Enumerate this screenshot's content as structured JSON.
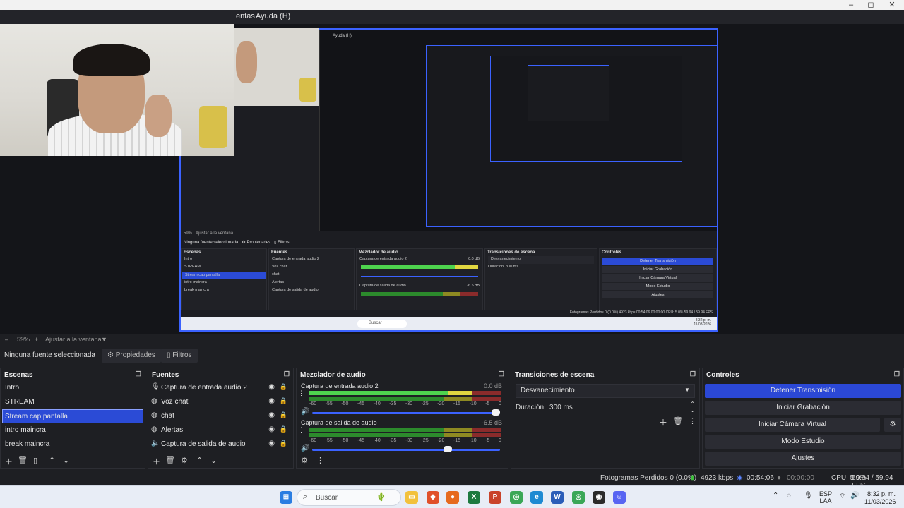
{
  "window": {
    "minimize": "–",
    "maximize": "◻",
    "close": "✕"
  },
  "menu": {
    "items": [
      "entas",
      "Ayuda (H)"
    ]
  },
  "nested_preview": {
    "menu_label": "Ayuda (H)",
    "zoom": "59%",
    "fit": "Ajustar a la ventana",
    "no_source": "Ninguna fuente seleccionada",
    "properties": "Propiedades",
    "filters": "Filtros",
    "panels": [
      "Escenas",
      "Fuentes",
      "Mezclador de audio",
      "Transiciones de escena",
      "Controles"
    ],
    "scenes": [
      "Intro",
      "STREAM",
      "Stream cap pantalla",
      "intro maincra",
      "break maincra"
    ],
    "sources": [
      "Captura de entrada audio 2",
      "Voz chat",
      "chat",
      "Alertas",
      "Captura de salida de audio"
    ],
    "mixer": [
      "Captura de entrada audio 2",
      "Captura de salida de audio"
    ],
    "mixer_db": [
      "0.0 dB",
      "-6.5 dB"
    ],
    "transition": "Desvanecimiento",
    "duration_label": "Duración",
    "duration": "300 ms",
    "controls": [
      "Detener Transmisión",
      "Iniciar Grabación",
      "Iniciar Cámara Virtual",
      "Modo Estudio",
      "Ajustes"
    ],
    "status": "Fotogramas Perdidos 0 (0.0%)   4923 kbps   00:54:06   00:00:00   CPU: 5.0%   59.94 / 59.94 FPS",
    "search": "Buscar",
    "clock_time": "8:32 p. m.",
    "clock_date": "11/03/2026"
  },
  "zoombar": {
    "minus": "–",
    "zoom": "59%",
    "plus": "+",
    "fit": "Ajustar a la ventana",
    "caret": "▼"
  },
  "sourcebar": {
    "no_source": "Ninguna fuente seleccionada",
    "properties": "Propiedades",
    "filters": "Filtros"
  },
  "scenes": {
    "title": "Escenas",
    "items": [
      "Intro",
      "STREAM",
      "Stream cap pantalla",
      "intro maincra",
      "break maincra"
    ],
    "selected_index": 2
  },
  "sources": {
    "title": "Fuentes",
    "items": [
      {
        "label": "Captura de entrada audio 2",
        "icon": "microphone-icon"
      },
      {
        "label": "Voz chat",
        "icon": "browser-icon"
      },
      {
        "label": "chat",
        "icon": "browser-icon"
      },
      {
        "label": "Alertas",
        "icon": "browser-icon"
      },
      {
        "label": "Captura de salida de audio",
        "icon": "speaker-icon"
      }
    ]
  },
  "mixer": {
    "title": "Mezclador de audio",
    "channels": [
      {
        "name": "Captura de entrada audio 2",
        "db": "0.0 dB",
        "level": 0.85,
        "volume": 1.0
      },
      {
        "name": "Captura de salida de audio",
        "db": "-6.5 dB",
        "level": 0.0,
        "volume": 0.74
      }
    ],
    "ticks": [
      "-60",
      "-55",
      "-50",
      "-45",
      "-40",
      "-35",
      "-30",
      "-25",
      "-20",
      "-15",
      "-10",
      "-5",
      "0"
    ]
  },
  "transitions": {
    "title": "Transiciones de escena",
    "selected": "Desvanecimiento",
    "duration_label": "Duración",
    "duration": "300 ms"
  },
  "controls": {
    "title": "Controles",
    "buttons": [
      "Detener Transmisión",
      "Iniciar Grabación",
      "Iniciar Cámara Virtual",
      "Modo Estudio",
      "Ajustes"
    ]
  },
  "status": {
    "dropped": "Fotogramas Perdidos 0 (0.0%)",
    "bitrate": "4923 kbps",
    "stream_time": "00:54:06",
    "rec_time": "00:00:00",
    "cpu": "CPU: 5.0%",
    "fps": "59.94 / 59.94 FPS"
  },
  "taskbar": {
    "search_placeholder": "Buscar",
    "lang_top": "ESP",
    "lang_bottom": "LAA",
    "time": "8:32 p. m.",
    "date": "11/03/2026"
  },
  "colors": {
    "accent": "#2b48d6",
    "selection_border": "#8aa0ff",
    "dock_bg": "#1e1f23"
  }
}
